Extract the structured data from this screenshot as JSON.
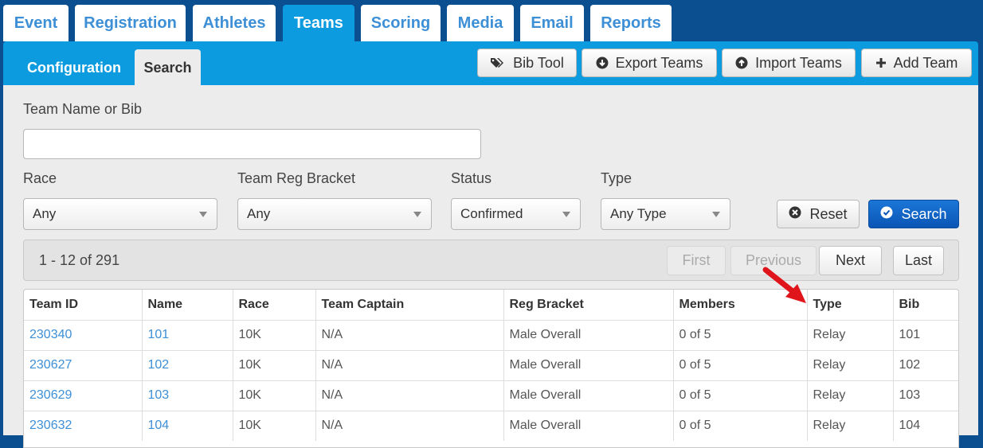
{
  "top_tabs": [
    "Event",
    "Registration",
    "Athletes",
    "Teams",
    "Scoring",
    "Media",
    "Email",
    "Reports"
  ],
  "active_top_tab": "Teams",
  "sub_tabs": {
    "configuration": "Configuration",
    "search": "Search"
  },
  "toolbar": {
    "bib_tool": "Bib Tool",
    "export_teams": "Export Teams",
    "import_teams": "Import Teams",
    "add_team": "Add Team"
  },
  "filters": {
    "team_name_label": "Team Name or Bib",
    "team_name_value": "",
    "race_label": "Race",
    "race_value": "Any",
    "bracket_label": "Team Reg Bracket",
    "bracket_value": "Any",
    "status_label": "Status",
    "status_value": "Confirmed",
    "type_label": "Type",
    "type_value": "Any Type",
    "reset_label": "Reset",
    "search_label": "Search"
  },
  "pager": {
    "count": "1 - 12 of 291",
    "first": "First",
    "previous": "Previous",
    "next": "Next",
    "last": "Last"
  },
  "table": {
    "columns": [
      "Team ID",
      "Name",
      "Race",
      "Team Captain",
      "Reg Bracket",
      "Members",
      "Type",
      "Bib"
    ],
    "rows": [
      [
        "230340",
        "101",
        "10K",
        "N/A",
        "Male Overall",
        "0 of 5",
        "Relay",
        "101"
      ],
      [
        "230627",
        "102",
        "10K",
        "N/A",
        "Male Overall",
        "0 of 5",
        "Relay",
        "102"
      ],
      [
        "230629",
        "103",
        "10K",
        "N/A",
        "Male Overall",
        "0 of 5",
        "Relay",
        "103"
      ],
      [
        "230632",
        "104",
        "10K",
        "N/A",
        "Male Overall",
        "0 of 5",
        "Relay",
        "104"
      ]
    ]
  },
  "colors": {
    "background": "#0b4f91",
    "band": "#0d9be0",
    "link": "#3d8fd6",
    "primary_button": "#0a55b4",
    "annotation_arrow": "#e0141b"
  },
  "icons": [
    "tags-icon",
    "download-circle-icon",
    "upload-circle-icon",
    "plus-icon",
    "times-circle-icon",
    "check-circle-icon",
    "caret-down-icon",
    "red-arrow-annotation"
  ]
}
